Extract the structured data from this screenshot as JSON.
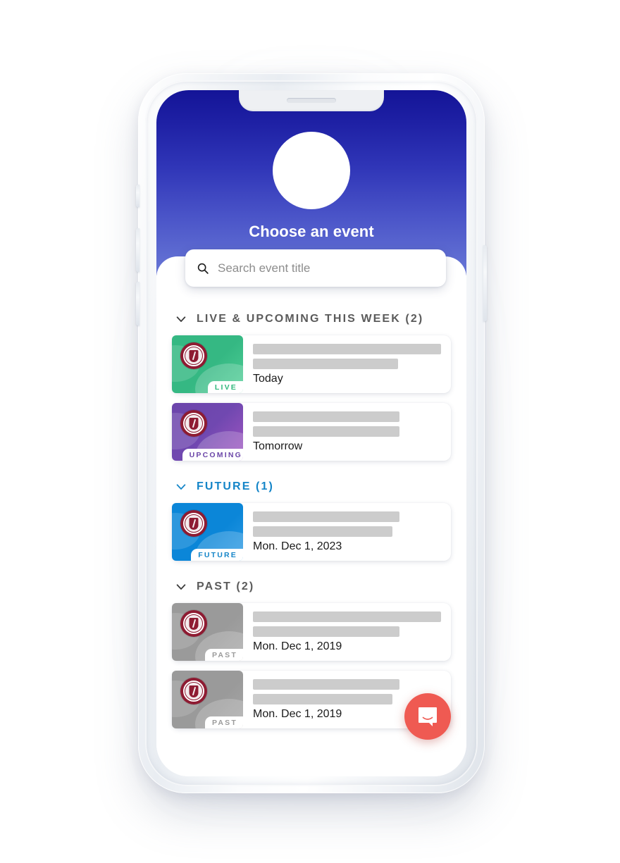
{
  "device": {
    "frame_name": "smartphone-mockup",
    "notch": "speaker-slot"
  },
  "header": {
    "title": "Choose an event",
    "avatar_alt": "event-avatar-placeholder",
    "gradient_top": "#141497",
    "gradient_bottom": "#6877d6"
  },
  "search": {
    "placeholder": "Search event title",
    "value": "",
    "icon": "search-icon"
  },
  "sections": [
    {
      "id": "live-upcoming",
      "label": "LIVE & UPCOMING THIS WEEK (2)",
      "count": 2,
      "color": "#5b5b5b",
      "expanded": true,
      "chevron": "chevron-down-icon"
    },
    {
      "id": "future",
      "label": "FUTURE (1)",
      "count": 1,
      "color": "#1485c8",
      "expanded": true,
      "chevron": "chevron-down-icon"
    },
    {
      "id": "past",
      "label": "PAST (2)",
      "count": 2,
      "color": "#5b5b5b",
      "expanded": true,
      "chevron": "chevron-down-icon"
    }
  ],
  "events": [
    {
      "badge": "LIVE",
      "badge_color": "#30b87c",
      "thumb_color_from": "#35b883",
      "thumb_color_to": "#4fcf96",
      "date": "Today",
      "logo": "university-seal-icon",
      "title_redacted": true
    },
    {
      "badge": "UPCOMING",
      "badge_color": "#6b46a8",
      "thumb_color_from": "#6c45ab",
      "thumb_color_to": "#9c55bd",
      "date": "Tomorrow",
      "logo": "university-seal-icon",
      "title_redacted": true
    },
    {
      "badge": "FUTURE",
      "badge_color": "#1485c8",
      "thumb_color_from": "#0b86d8",
      "thumb_color_to": "#1f95e0",
      "date": "Mon. Dec 1, 2023",
      "logo": "university-seal-icon",
      "title_redacted": true
    },
    {
      "badge": "PAST",
      "badge_color": "#9b9b9b",
      "thumb_color_from": "#9a9a9a",
      "thumb_color_to": "#a6a6a6",
      "date": "Mon. Dec 1, 2019",
      "logo": "university-seal-icon",
      "title_redacted": true
    },
    {
      "badge": "PAST",
      "badge_color": "#9b9b9b",
      "thumb_color_from": "#9a9a9a",
      "thumb_color_to": "#a6a6a6",
      "date": "Mon. Dec 1, 2019",
      "logo": "university-seal-icon",
      "title_redacted": true
    }
  ],
  "chat": {
    "icon": "chat-bubble-icon",
    "color": "#ef5a52",
    "label": ""
  }
}
